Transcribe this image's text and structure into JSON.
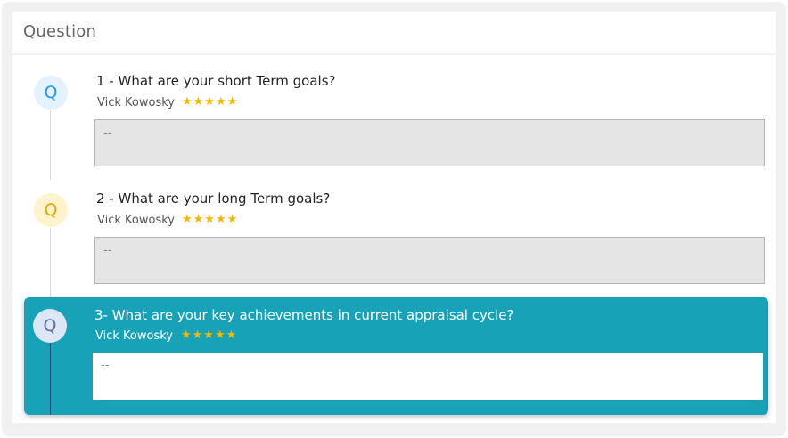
{
  "header": {
    "title": "Question"
  },
  "questions": [
    {
      "badge": "Q",
      "title": "1 - What are your short Term goals?",
      "author": "Vick Kowosky",
      "stars": "★★★★★",
      "answer": "--",
      "badge_bg": "#e3f2fd",
      "badge_color": "#2196f3"
    },
    {
      "badge": "Q",
      "title": "2 - What are your long Term goals?",
      "author": "Vick Kowosky",
      "stars": "★★★★★",
      "answer": "--",
      "badge_bg": "#fff3cd",
      "badge_color": "#e0a800"
    },
    {
      "badge": "Q",
      "title": "3- What are your key achievements in current appraisal cycle?",
      "author": "Vick Kowosky",
      "stars": "★★★★★",
      "answer": "--",
      "badge_bg": "#dde6f5",
      "badge_color": "#5e6f95"
    }
  ],
  "colors": {
    "accent": "#17a2b8",
    "star": "#f5b800"
  }
}
